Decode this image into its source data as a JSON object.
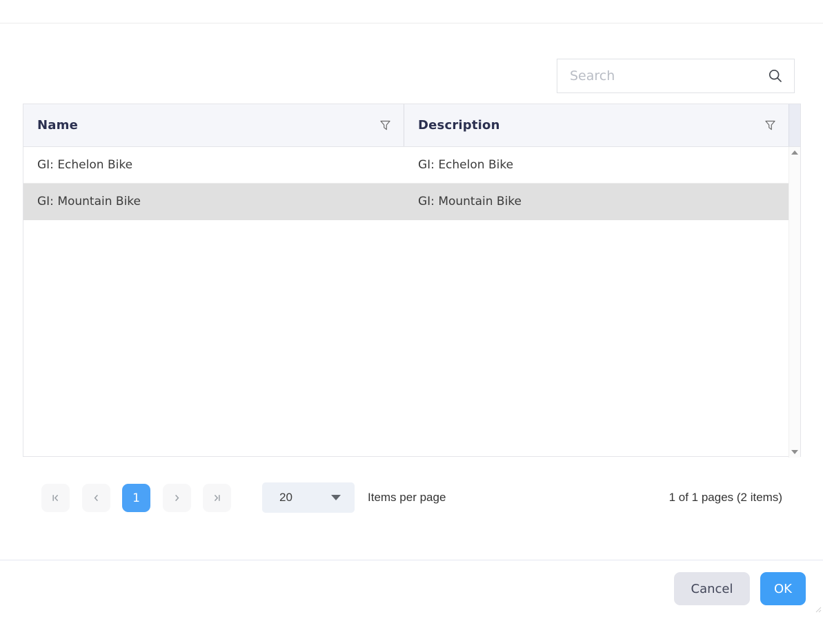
{
  "search": {
    "placeholder": "Search"
  },
  "table": {
    "columns": [
      {
        "label": "Name"
      },
      {
        "label": "Description"
      }
    ],
    "rows": [
      {
        "name": "GI: Echelon Bike",
        "description": "GI: Echelon Bike",
        "selected": false
      },
      {
        "name": "GI: Mountain Bike",
        "description": "GI: Mountain Bike",
        "selected": true
      }
    ],
    "selected_row_index": 1
  },
  "pager": {
    "current_page": "1",
    "page_size": "20",
    "items_per_page_label": "Items per page",
    "info": "1 of 1 pages (2 items)"
  },
  "footer": {
    "cancel_label": "Cancel",
    "ok_label": "OK"
  },
  "icons": {
    "search": "magnifier",
    "column_filter": "funnel",
    "pager": [
      "first-page",
      "previous-page",
      "next-page",
      "last-page"
    ],
    "page_size_caret": "triangle-down",
    "scrollbar": [
      "triangle-up",
      "triangle-down"
    ]
  },
  "colors": {
    "accent_blue": "#3f9ff7",
    "active_page_blue": "#4ba2f7",
    "selected_row": "#e0e0e0",
    "header_bg": "#f5f6fa",
    "header_text": "#2b3050",
    "cancel_bg": "#e3e4eb",
    "pager_button_bg": "#f7f7f8",
    "page_size_bg": "#edf1f7"
  }
}
